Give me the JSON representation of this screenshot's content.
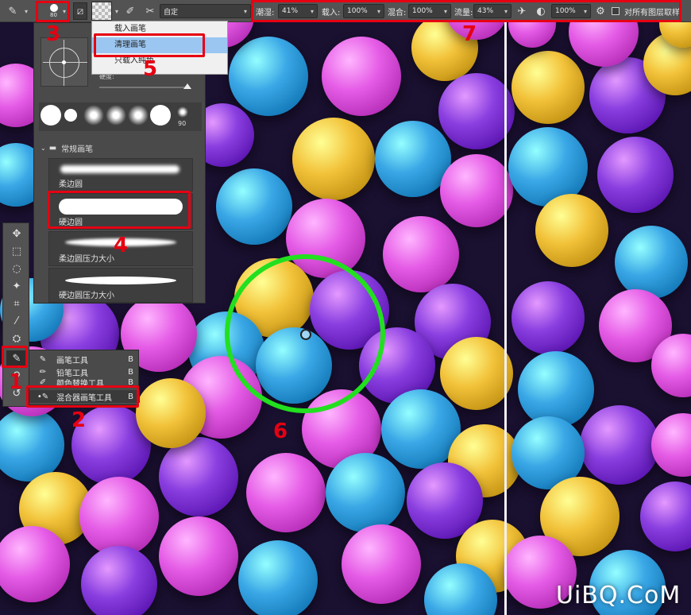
{
  "options_bar": {
    "brush_size": "80",
    "preset_value": "自定",
    "wet_label": "潮湿:",
    "wet_value": "41%",
    "load_label": "载入:",
    "load_value": "100%",
    "mix_label": "混合:",
    "mix_value": "100%",
    "flow_label": "流量:",
    "flow_value": "43%",
    "angle_value": "100%",
    "sample_all_label": "对所有图层取样"
  },
  "load_menu": {
    "items": [
      "载入画笔",
      "清理画笔",
      "只载入纯色"
    ]
  },
  "brush_panel": {
    "angle_label": "硬度:",
    "preset_size_90": "90",
    "group_title": "常规画笔",
    "brushes": [
      "柔边圆",
      "硬边圆",
      "柔边圆压力大小",
      "硬边圆压力大小"
    ]
  },
  "tool_flyout": {
    "items": [
      {
        "label": "画笔工具",
        "key": "B"
      },
      {
        "label": "铅笔工具",
        "key": "B"
      },
      {
        "label": "颜色替换工具",
        "key": "B"
      },
      {
        "label": "混合器画笔工具",
        "key": "B"
      }
    ]
  },
  "annotations": {
    "n1": "1",
    "n2": "2",
    "n3": "3",
    "n4": "4",
    "n5": "5",
    "n6": "6",
    "n7": "7"
  },
  "watermark": "UiBQ.CoM",
  "colors": {
    "pink": "#e55ce6",
    "purple": "#8a3fe0",
    "blue": "#3aa7e6",
    "yellow": "#f2c23a",
    "annotation_red": "#e60012",
    "annotation_green": "#22e01f"
  }
}
